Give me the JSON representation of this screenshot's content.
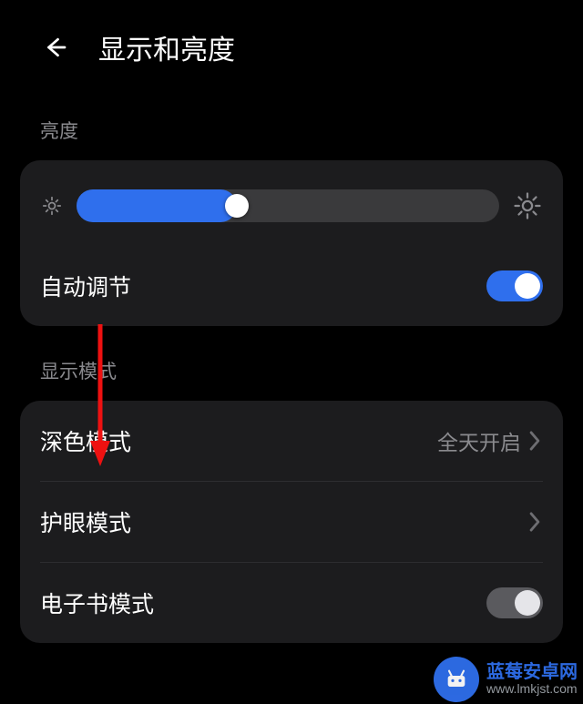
{
  "header": {
    "title": "显示和亮度"
  },
  "sections": {
    "brightness_label": "亮度",
    "display_mode_label": "显示模式"
  },
  "brightness": {
    "auto_label": "自动调节",
    "auto_on": true,
    "slider_percent": 38
  },
  "display_modes": {
    "dark_mode": {
      "label": "深色模式",
      "value": "全天开启"
    },
    "eye_care": {
      "label": "护眼模式"
    },
    "ebook": {
      "label": "电子书模式",
      "on": false
    }
  },
  "watermark": {
    "line1": "蓝莓安卓网",
    "line2": "www.lmkjst.com"
  },
  "colors": {
    "accent": "#2f6fed",
    "card_bg": "#1c1c1e",
    "muted": "#8a8a8e"
  }
}
